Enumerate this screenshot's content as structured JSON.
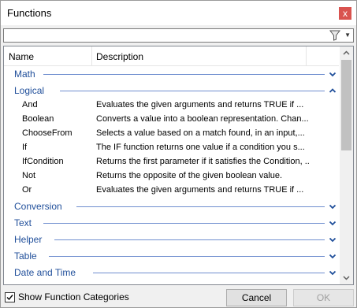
{
  "window": {
    "title": "Functions",
    "close_glyph": "x"
  },
  "search": {
    "value": "",
    "placeholder": ""
  },
  "columns": {
    "name": "Name",
    "description": "Description"
  },
  "groups_top": [
    {
      "label": "Math",
      "expanded": false
    }
  ],
  "logical": {
    "label": "Logical",
    "expanded": true,
    "items": [
      {
        "name": "And",
        "description": "Evaluates the given arguments and returns TRUE if ..."
      },
      {
        "name": "Boolean",
        "description": "Converts a value into a boolean representation. Chan..."
      },
      {
        "name": "ChooseFrom",
        "description": "Selects a value based on a match found, in an input,..."
      },
      {
        "name": "If",
        "description": "The IF function returns one value if a condition you s..."
      },
      {
        "name": "IfCondition",
        "description": "Returns the first parameter if it satisfies the Condition, ..."
      },
      {
        "name": "Not",
        "description": "Returns the opposite of the given boolean value."
      },
      {
        "name": "Or",
        "description": "Evaluates the given arguments and returns TRUE if ..."
      }
    ]
  },
  "groups_bottom": [
    {
      "label": "Conversion",
      "expanded": false
    },
    {
      "label": "Text",
      "expanded": false
    },
    {
      "label": "Helper",
      "expanded": false
    },
    {
      "label": "Table",
      "expanded": false
    },
    {
      "label": "Date and Time",
      "expanded": false
    }
  ],
  "footer": {
    "show_categories_label": "Show Function Categories",
    "show_categories_checked": true,
    "cancel_label": "Cancel",
    "ok_label": "OK"
  },
  "colors": {
    "group_text": "#1f4e9a",
    "close_button": "#d9534f"
  }
}
